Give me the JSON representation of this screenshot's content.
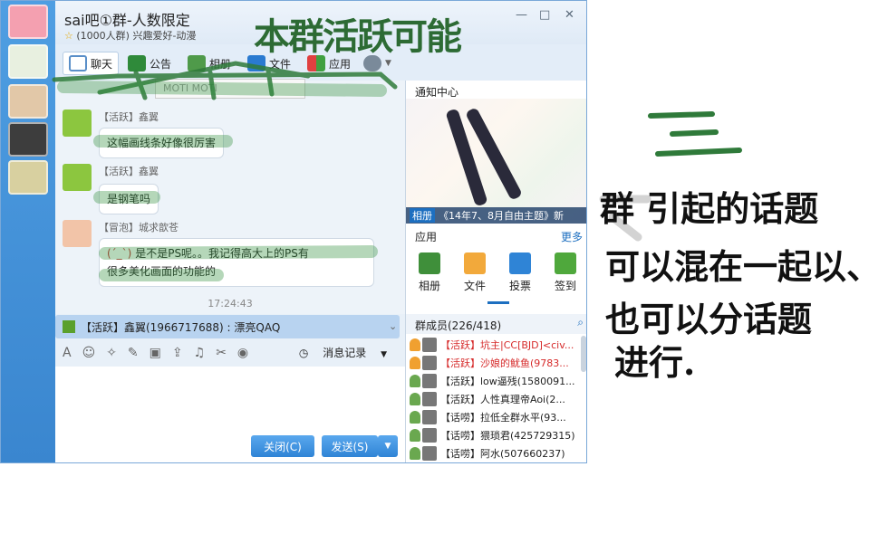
{
  "window": {
    "title": "sai吧①群-人数限定",
    "subtitle_star": "☆",
    "subtitle": "(1000人群) 兴趣爱好-动漫",
    "minimize": "—",
    "maximize": "□",
    "close": "✕"
  },
  "toolbar": {
    "tabs": [
      {
        "label": "聊天"
      },
      {
        "label": "公告"
      },
      {
        "label": "相册"
      },
      {
        "label": "文件"
      },
      {
        "label": "应用"
      }
    ],
    "settings_icon": "gear-icon",
    "file_chip": "MOTI   MOTI"
  },
  "chat": {
    "messages": [
      {
        "name": "【活跃】鑫翼",
        "text": "这幅画线条好像很厉害"
      },
      {
        "name": "【活跃】鑫翼",
        "text": "是钢笔吗"
      },
      {
        "name": "【冒泡】城求歆苍",
        "emoticon": "(ˊ_ˋ)",
        "text_line1": "是不是PS呢。。我记得高大上的PS有",
        "text_line2": "很多美化画面的功能的"
      }
    ],
    "time": "17:24:43",
    "mention": "【活跃】鑫翼(1966717688) : 漂亮QAQ",
    "history_label": "消息记录",
    "close_button": "关闭(C)",
    "send_button": "发送(S)"
  },
  "right_panel": {
    "notice_title": "通知中心",
    "banner_tag": "相册",
    "banner_caption": "《14年7、8月自由主题》新",
    "apps_title": "应用",
    "apps_more": "更多",
    "apps": [
      {
        "label": "相册"
      },
      {
        "label": "文件"
      },
      {
        "label": "投票"
      },
      {
        "label": "签到"
      }
    ],
    "members_title": "群成员(226/418)",
    "members": [
      {
        "text": "【活跃】坑主|CC[BJD]<civ...",
        "owner": true
      },
      {
        "text": "【活跃】沙娘的鱿鱼(9783...",
        "owner": true
      },
      {
        "text": "【活跃】low逼残(1580091...",
        "owner": false
      },
      {
        "text": "【活跃】人性真理帝Aoi(2...",
        "owner": false
      },
      {
        "text": "【话唠】拉低全群水平(93...",
        "owner": false
      },
      {
        "text": "【话唠】猥琐君(425729315)",
        "owner": false
      },
      {
        "text": "【话唠】阿水(507660237)",
        "owner": false
      }
    ]
  },
  "annotations": {
    "heading": "本群活跃可能",
    "numeral": "三",
    "line1": "群 引起的话题",
    "line2": "可以混在一起以、",
    "line3": "也可以分话题",
    "line4": "进行."
  }
}
